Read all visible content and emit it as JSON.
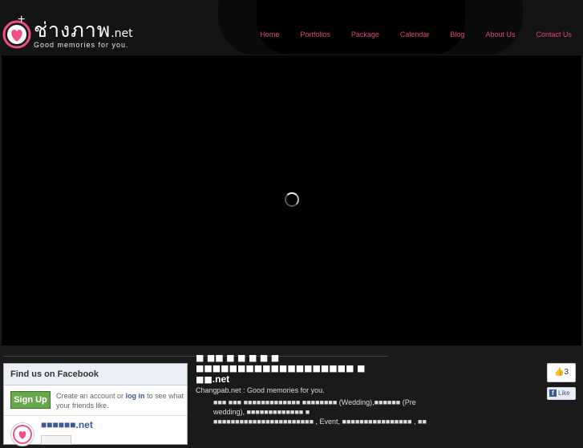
{
  "header": {
    "logo_text": "ช่างภาพ",
    "logo_suffix": ".net",
    "tagline": "Good memories for you."
  },
  "nav": {
    "items": [
      "Home",
      "Portfolios",
      "Package",
      "Calendar",
      "Blog",
      "About Us",
      "Contact Us"
    ]
  },
  "facebook": {
    "title": "Find us on Facebook",
    "signup_label": "Sign Up",
    "text_before": "Create an account or ",
    "login_label": "log in",
    "text_after": " to see what your friends like.",
    "page_name": "■■■■■■.net"
  },
  "about": {
    "line1": "■ ■■ ■ ■ ■ ■ ■",
    "line2": "■■■■■■■■■■■■■■■■■■■ ■",
    "title_boxes": "■■",
    "title_suffix": ".net",
    "tagline": "Changpab.net : Good memories for you.",
    "desc1": "■■■ ■■■ ■■■■■■■■■■■■■ ■■■■■■■■ (Wedding),■■■■■■ (Pre",
    "desc2": "wedding), ■■■■■■■■■■■■■ ■",
    "desc3": "■■■■■■■■■■■■■■■■■■■■■■■ , Event, ■■■■■■■■■■■■■■■■ , ■■"
  },
  "like_widget": {
    "count": "3",
    "like_label": "Like"
  },
  "colors": {
    "accent": "#e0457b",
    "background": "#1a1a1a",
    "facebook_blue": "#3b5998",
    "signup_green": "#69a74e"
  }
}
